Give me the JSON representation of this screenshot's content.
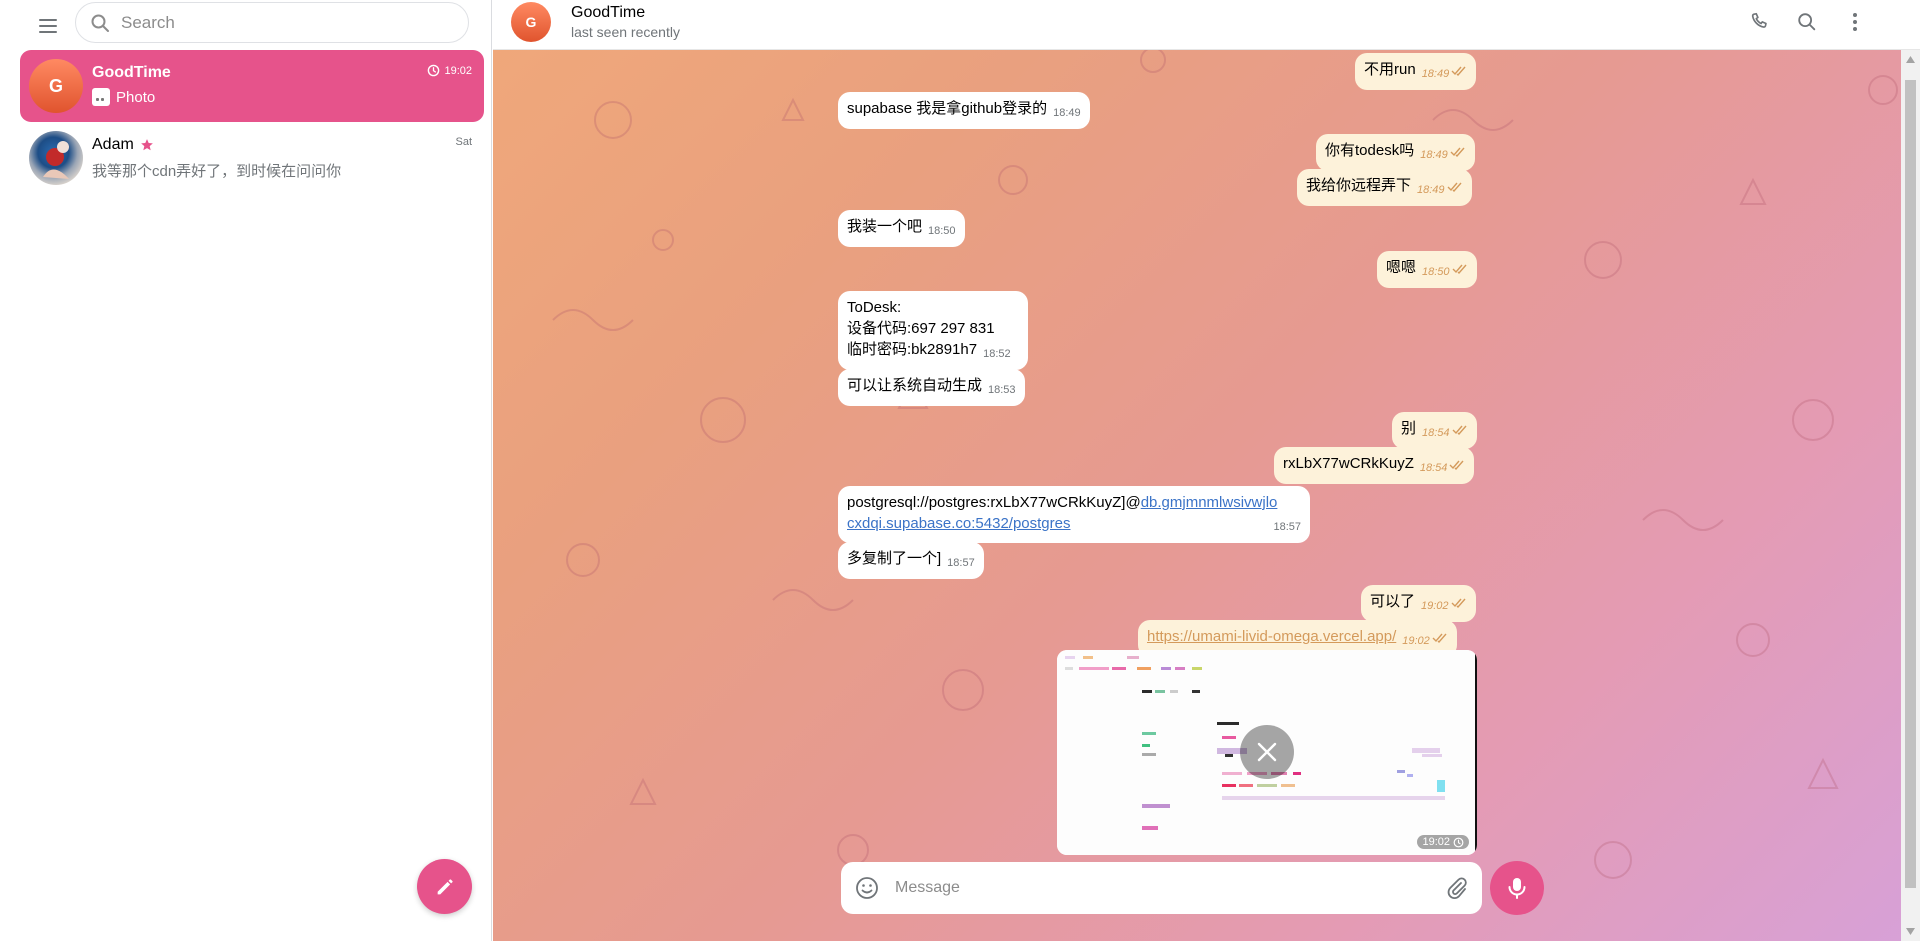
{
  "sidebar": {
    "search_placeholder": "Search",
    "chats": [
      {
        "name": "GoodTime",
        "initial": "G",
        "time": "19:02",
        "preview": "Photo",
        "preview_icon": "photo-thumb-icon",
        "active": true
      },
      {
        "name": "Adam",
        "badge_icon": "star-icon",
        "time": "Sat",
        "preview": "我等那个cdn弄好了，到时候在问问你",
        "active": false
      }
    ],
    "compose_icon": "pencil-icon"
  },
  "topbar": {
    "avatar_initial": "G",
    "title": "GoodTime",
    "status": "last seen recently",
    "icons": [
      "phone-icon",
      "search-icon",
      "more-vertical-icon"
    ]
  },
  "messages": [
    {
      "dir": "out",
      "text": "不用run",
      "time": "18:49"
    },
    {
      "dir": "in",
      "text": "supabase 我是拿github登录的",
      "time": "18:49"
    },
    {
      "dir": "out",
      "text": "你有todesk吗",
      "time": "18:49"
    },
    {
      "dir": "out",
      "text": "我给你远程弄下",
      "time": "18:49"
    },
    {
      "dir": "in",
      "text": "我装一个吧",
      "time": "18:50"
    },
    {
      "dir": "out",
      "text": "嗯嗯",
      "time": "18:50"
    },
    {
      "dir": "in",
      "lines": [
        "ToDesk:",
        "设备代码:697 297 831",
        "临时密码:bk2891h7"
      ],
      "time": "18:52"
    },
    {
      "dir": "in",
      "text": "可以让系统自动生成",
      "time": "18:53"
    },
    {
      "dir": "out",
      "text": "别",
      "time": "18:54"
    },
    {
      "dir": "out",
      "text": "rxLbX77wCRkKuyZ",
      "time": "18:54"
    },
    {
      "dir": "in",
      "prefix": "postgresql://postgres:rxLbX77wCRkKuyZ]@",
      "link_line1": "db.gmjmnmlwsivwjlo",
      "link_line2": "cxdqi.supabase.co:5432/postgres",
      "time": "18:57"
    },
    {
      "dir": "in",
      "text": "多复制了一个]",
      "time": "18:57"
    },
    {
      "dir": "out",
      "text": "可以了",
      "time": "19:02"
    },
    {
      "dir": "out",
      "link": "https://umami-livid-omega.vercel.app/",
      "time": "19:02"
    }
  ],
  "photo": {
    "time": "19:02",
    "status_icon": "clock-icon",
    "cancel_icon": "close-icon"
  },
  "composer": {
    "placeholder": "Message",
    "emoji_icon": "smile-icon",
    "attach_icon": "paperclip-icon",
    "mic_icon": "microphone-icon"
  },
  "colors": {
    "accent": "#e6538b",
    "outgoing_bubble": "#fdf2da",
    "incoming_bubble": "#ffffff",
    "time_out": "#d49a5b"
  }
}
